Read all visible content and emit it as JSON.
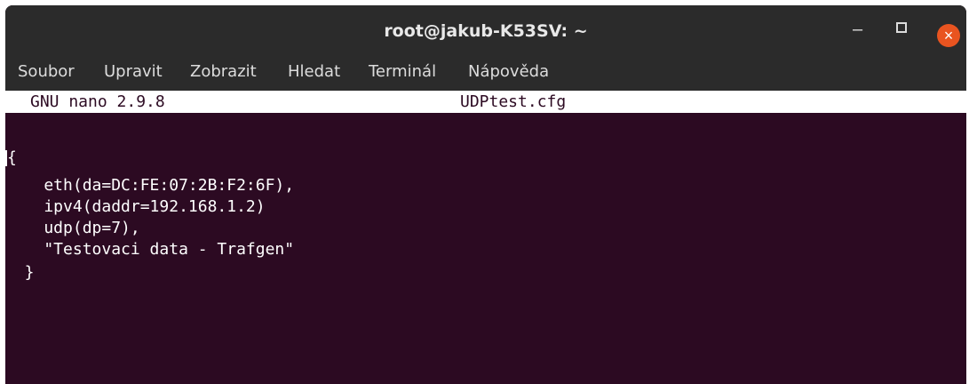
{
  "window": {
    "title": "root@jakub-K53SV: ~",
    "controls": {
      "minimize": "–",
      "close": "×"
    }
  },
  "menu": {
    "items": [
      "Soubor",
      "Upravit",
      "Zobrazit",
      "Hledat",
      "Terminál",
      "Nápověda"
    ]
  },
  "nano": {
    "version": "GNU nano 2.9.8",
    "filename": "UDPtest.cfg"
  },
  "buffer": {
    "lines": [
      "{",
      "    eth(da=DC:FE:07:2B:F2:6F),",
      "    ipv4(daddr=192.168.1.2)",
      "    udp(dp=7),",
      "    \"Testovaci data - Trafgen\"",
      "  }"
    ]
  },
  "colors": {
    "terminal_bg": "#2c0a22",
    "titlebar_bg": "#2b2b2b",
    "close_button": "#e95420"
  }
}
